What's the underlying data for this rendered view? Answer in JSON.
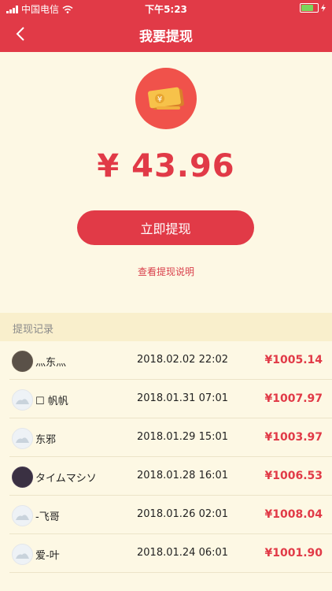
{
  "status_bar": {
    "carrier": "中国电信",
    "time": "下午5:23"
  },
  "nav": {
    "back_glyph": "‹",
    "title": "我要提现"
  },
  "balance": {
    "amount": "¥ 43.96"
  },
  "withdraw_button": {
    "label": "立即提现"
  },
  "explain_link": {
    "label": "查看提现说明"
  },
  "records_header": "提现记录",
  "records": [
    {
      "name": "灬东灬",
      "date": "2018.02.02 22:02",
      "amount": "¥1005.14",
      "avatar": "photo"
    },
    {
      "name": "☐ 帆帆",
      "date": "2018.01.31 07:01",
      "amount": "¥1007.97",
      "avatar": "default"
    },
    {
      "name": "东邪",
      "date": "2018.01.29 15:01",
      "amount": "¥1003.97",
      "avatar": "default"
    },
    {
      "name": "タイムマシソ",
      "date": "2018.01.28 16:01",
      "amount": "¥1006.53",
      "avatar": "photo2"
    },
    {
      "name": "-飞哥",
      "date": "2018.01.26 02:01",
      "amount": "¥1008.04",
      "avatar": "default"
    },
    {
      "name": "爱-叶",
      "date": "2018.01.24 06:01",
      "amount": "¥1001.90",
      "avatar": "default"
    }
  ],
  "icons": {
    "wallet": "red-envelope-wallet-icon",
    "back": "chevron-left-icon",
    "wifi": "wifi-icon",
    "battery": "battery-icon"
  },
  "colors": {
    "primary": "#e13a47",
    "background": "#fdf8e4",
    "section": "#f9efcc",
    "battery_fill": "#7bd65b"
  }
}
